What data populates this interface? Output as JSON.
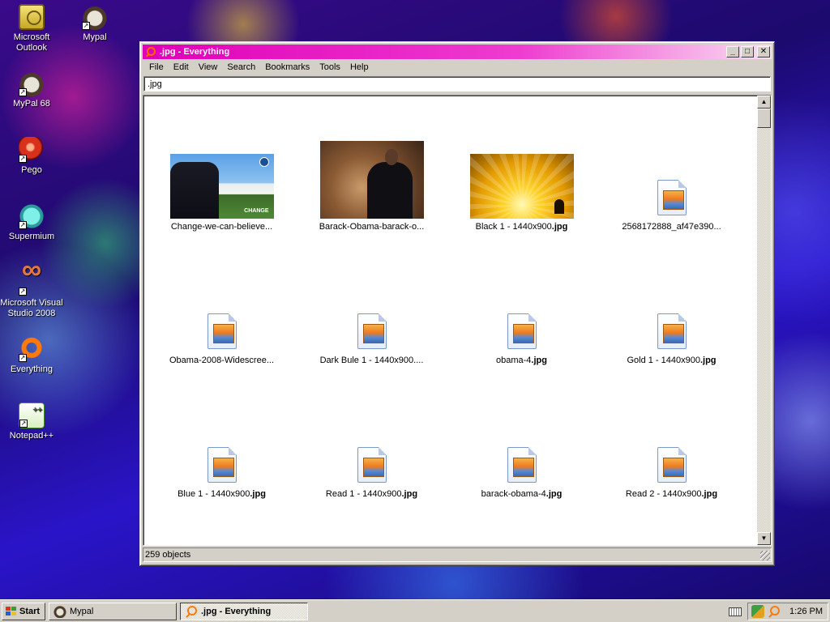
{
  "desktop": {
    "icons": [
      {
        "label": "Microsoft Outlook",
        "icon": "outlook-icon"
      },
      {
        "label": "Mypal",
        "icon": "mypal-icon"
      },
      {
        "label": "MyPal 68",
        "icon": "mypal-icon"
      },
      {
        "label": "Pego",
        "icon": "pego-icon"
      },
      {
        "label": "Supermium",
        "icon": "supermium-icon"
      },
      {
        "label": "Microsoft Visual Studio 2008",
        "icon": "visual-studio-icon"
      },
      {
        "label": "Everything",
        "icon": "everything-icon"
      },
      {
        "label": "Notepad++",
        "icon": "notepad-plus-plus-icon"
      }
    ]
  },
  "window": {
    "title": ".jpg - Everything",
    "buttons": {
      "minimize": "_",
      "maximize": "□",
      "close": "✕"
    },
    "menu": [
      "File",
      "Edit",
      "View",
      "Search",
      "Bookmarks",
      "Tools",
      "Help"
    ],
    "search": {
      "value": ".jpg",
      "placeholder": ""
    },
    "files": [
      {
        "name": "Change-we-can-believe...",
        "ext": "",
        "thumb": "whitehouse",
        "thumb_text": "CHANGE"
      },
      {
        "name": "Barack-Obama-barack-o...",
        "ext": "",
        "thumb": "crowd"
      },
      {
        "name": "Black 1 - 1440x900",
        "ext": ".jpg",
        "thumb": "gold"
      },
      {
        "name": "2568172888_af47e390...",
        "ext": "",
        "thumb": "file-icon"
      },
      {
        "name": "Obama-2008-Widescree...",
        "ext": "",
        "thumb": "file-icon"
      },
      {
        "name": "Dark Bule 1 - 1440x900....",
        "ext": "",
        "thumb": "file-icon"
      },
      {
        "name": "obama-4",
        "ext": ".jpg",
        "thumb": "file-icon"
      },
      {
        "name": "Gold 1 - 1440x900",
        "ext": ".jpg",
        "thumb": "file-icon"
      },
      {
        "name": "Blue 1 - 1440x900",
        "ext": ".jpg",
        "thumb": "file-icon"
      },
      {
        "name": "Read 1 - 1440x900",
        "ext": ".jpg",
        "thumb": "file-icon"
      },
      {
        "name": "barack-obama-4",
        "ext": ".jpg",
        "thumb": "file-icon"
      },
      {
        "name": "Read 2 - 1440x900",
        "ext": ".jpg",
        "thumb": "file-icon"
      }
    ],
    "status": "259 objects"
  },
  "taskbar": {
    "start_label": "Start",
    "tasks": [
      {
        "label": "Mypal",
        "icon": "mypal-icon",
        "active": false
      },
      {
        "label": ".jpg - Everything",
        "icon": "everything-icon",
        "active": true
      }
    ],
    "clock": "1:26 PM"
  },
  "colors": {
    "title_active": "#e000b8",
    "window_face": "#d4d0c8"
  }
}
